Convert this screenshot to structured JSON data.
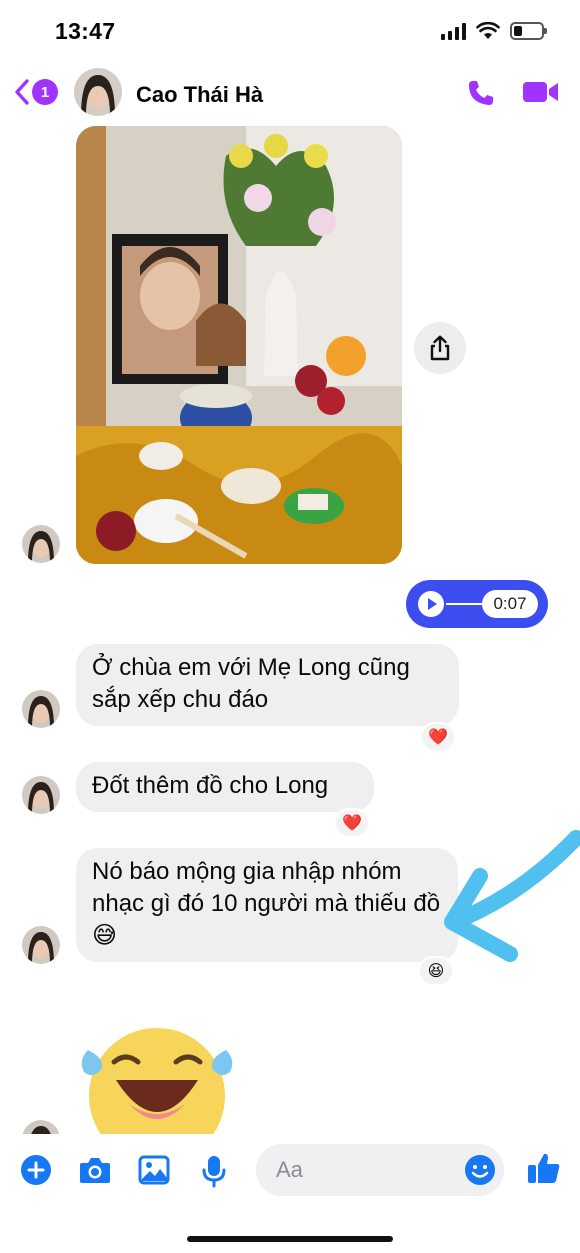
{
  "status_bar": {
    "time": "13:47",
    "battery_level": 0.3
  },
  "header": {
    "back_badge": "1",
    "contact_name": "Cao Thái Hà",
    "accent_color": "#a033ff",
    "icons": [
      "chevron-left-icon",
      "phone-icon",
      "video-camera-icon"
    ]
  },
  "messages": [
    {
      "kind": "photo",
      "description_icon": "photo",
      "action_icon": "share-icon"
    },
    {
      "kind": "voice",
      "duration": "0:07",
      "outgoing": true
    },
    {
      "kind": "text",
      "text": "Ở chùa em với Mẹ Long cũng sắp xếp chu đáo",
      "reaction": "❤️"
    },
    {
      "kind": "text",
      "text": "Đốt thêm đồ cho Long",
      "reaction": "❤️"
    },
    {
      "kind": "text",
      "text": "Nó báo mộng gia nhập nhóm nhạc gì đó 10 người mà thiếu đồ 😅",
      "reaction": "😆"
    },
    {
      "kind": "sticker",
      "sticker_icon": "laughing-tears-icon"
    }
  ],
  "composer": {
    "placeholder": "Aa",
    "icons": [
      "plus-icon",
      "camera-icon",
      "image-icon",
      "microphone-icon",
      "emoji-icon",
      "thumbs-up-icon"
    ],
    "icon_color": "#1877f2"
  }
}
